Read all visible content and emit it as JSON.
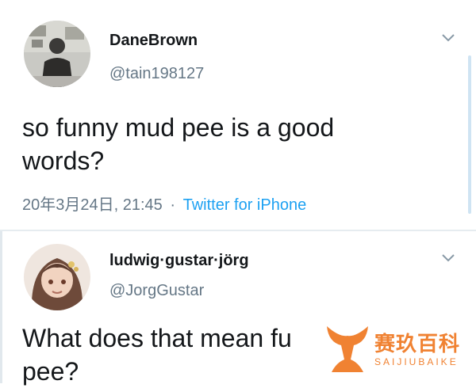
{
  "tweets": [
    {
      "display_name": "DaneBrown",
      "handle": "@tain198127",
      "body_line1": "so funny mud pee is a good",
      "body_line2": "words?",
      "date": "20年3月24日, 21:45",
      "separator": "·",
      "source": "Twitter for iPhone",
      "avatar_icon": "user-photo-avatar",
      "chevron_icon": "chevron-down-icon"
    },
    {
      "display_name": "ludwig·gustar·jörg",
      "handle": "@JorgGustar",
      "body_line1": "What does that mean fu",
      "body_line2": "pee?",
      "avatar_icon": "anime-avatar",
      "chevron_icon": "chevron-down-icon"
    }
  ],
  "watermark": {
    "cn": "赛玖百科",
    "en": "SAIJIUBAIKE",
    "color": "#f08232"
  },
  "colors": {
    "name": "#14171a",
    "handle": "#657786",
    "link": "#1da1f2",
    "divider": "#e6ecf0"
  }
}
